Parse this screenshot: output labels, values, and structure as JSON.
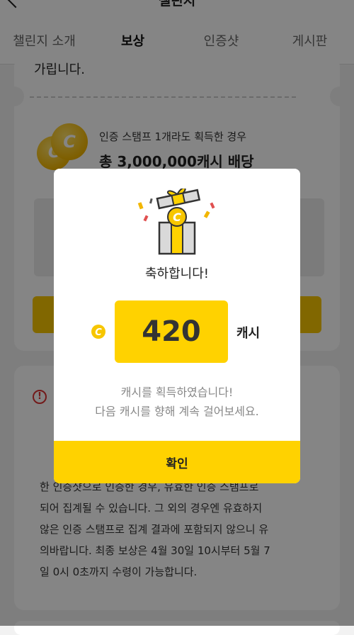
{
  "header": {
    "title": "챌린지"
  },
  "tabs": [
    {
      "label": "챌린지 소개"
    },
    {
      "label": "보상"
    },
    {
      "label": "인증샷"
    },
    {
      "label": "게시판"
    }
  ],
  "background": {
    "top_text": "가립니다.",
    "reward_condition": "인증 스탬프 1개라도 획득한 경우",
    "reward_amount": "총 3,000,000캐시 배당",
    "notice_lines": [
      "한 인증샷으로 인증한 경우, 유효한 인증 스탬프로",
      "되어 집계될 수 있습니다. 그 외의 경우엔 유효하지",
      "않은 인증 스탬프로 집계 결과에 포함되지 않으니 유",
      "의바랍니다. 최종 보상은 4월 30일 10시부터 5월 7",
      "일 0시 0초까지 수령이 가능합니다."
    ]
  },
  "modal": {
    "title": "축하합니다!",
    "amount": "420",
    "unit": "캐시",
    "message_line1": "캐시를 획득하였습니다!",
    "message_line2": "다음 캐시를 향해 계속 걸어보세요.",
    "confirm_label": "확인",
    "coin_glyph": "C"
  },
  "colors": {
    "accent_yellow": "#ffd200",
    "overlay": "rgba(0,0,0,0.48)",
    "warning_red": "#d33333"
  },
  "icons": [
    "back-icon",
    "more-icon",
    "coin-icon",
    "gift-icon",
    "warning-icon"
  ]
}
